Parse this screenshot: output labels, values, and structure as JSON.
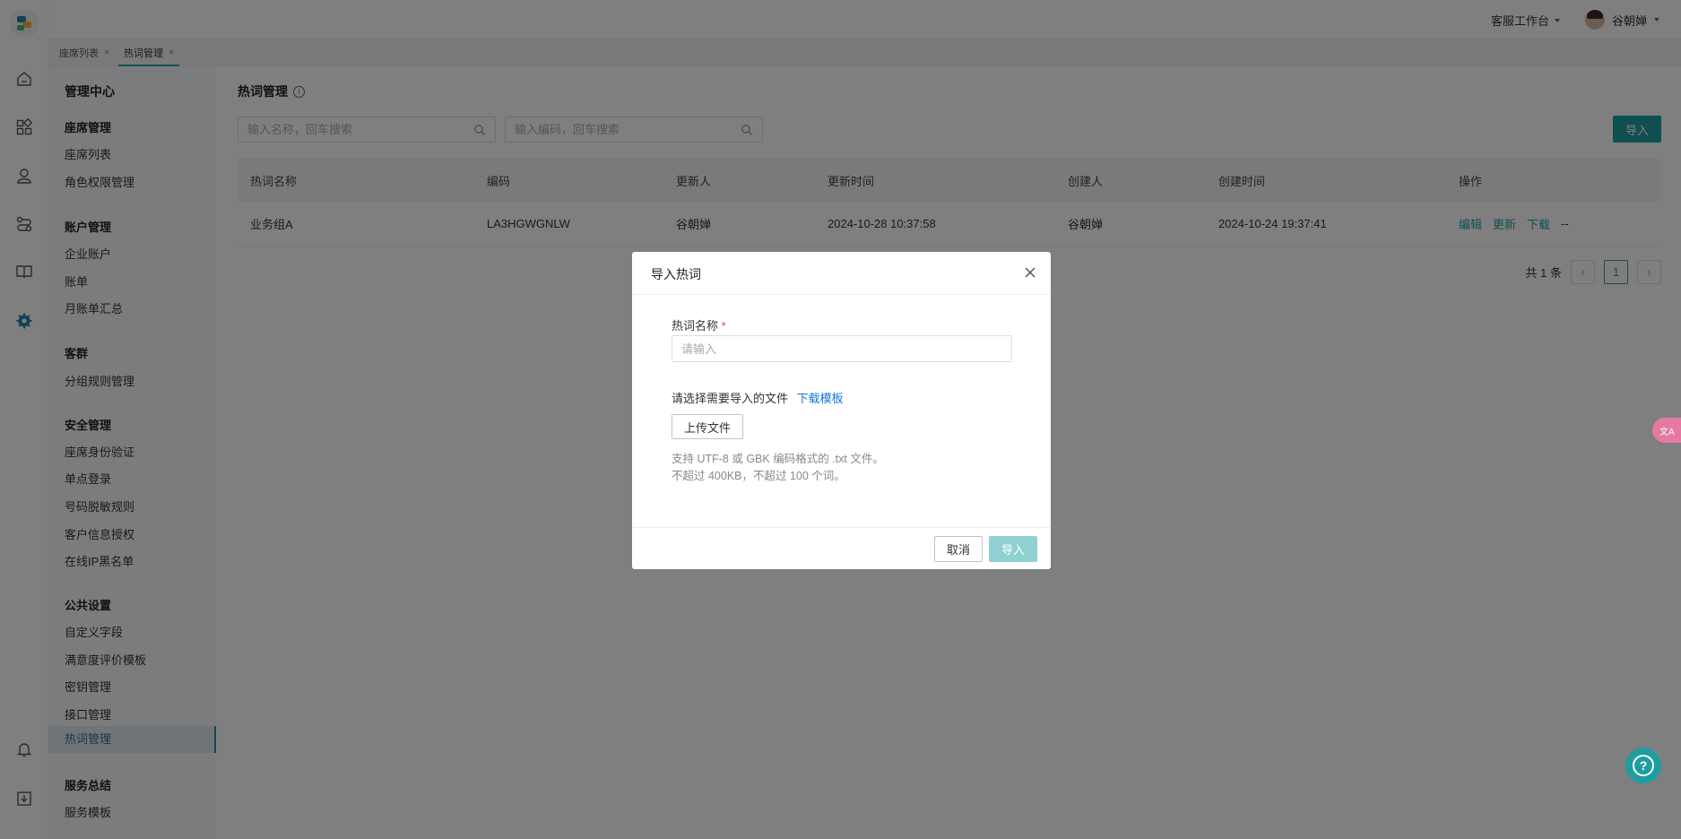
{
  "topbar": {
    "workbench_label": "客服工作台",
    "user_name": "谷朝婵"
  },
  "tabs": [
    {
      "label": "座席列表",
      "close": "×"
    },
    {
      "label": "热词管理",
      "close": "×"
    }
  ],
  "sidebar": {
    "title": "管理中心",
    "groups": [
      {
        "title": "座席管理",
        "items": [
          "座席列表",
          "角色权限管理"
        ]
      },
      {
        "title": "账户管理",
        "items": [
          "企业账户",
          "账单",
          "月账单汇总"
        ]
      },
      {
        "title": "客群",
        "items": [
          "分组规则管理"
        ]
      },
      {
        "title": "安全管理",
        "items": [
          "座席身份验证",
          "单点登录",
          "号码脱敏规则",
          "客户信息授权",
          "在线IP黑名单"
        ]
      },
      {
        "title": "公共设置",
        "items": [
          "自定义字段",
          "满意度评价模板",
          "密钥管理",
          "接口管理",
          "热词管理"
        ]
      },
      {
        "title": "服务总结",
        "items": [
          "服务模板"
        ]
      }
    ]
  },
  "main": {
    "title": "热词管理",
    "info_glyph": "i",
    "search_name_placeholder": "输入名称，回车搜索",
    "search_code_placeholder": "输入编码，回车搜索",
    "import_label": "导入",
    "table": {
      "headers": [
        "热词名称",
        "编码",
        "更新人",
        "更新时间",
        "创建人",
        "创建时间",
        "操作"
      ],
      "rows": [
        {
          "name": "业务组A",
          "code": "LA3HGWGNLW",
          "updater": "谷朝婵",
          "updated_at": "2024-10-28 10:37:58",
          "creator": "谷朝婵",
          "created_at": "2024-10-24 19:37:41",
          "actions": [
            "编辑",
            "更新",
            "下载",
            "--"
          ]
        }
      ]
    },
    "pagination": {
      "total_label": "共 1 条",
      "current_page": "1",
      "prev": "‹",
      "next": "›"
    }
  },
  "dialog": {
    "title": "导入热词",
    "name_label": "热词名称",
    "required_mark": "*",
    "name_placeholder": "请输入",
    "file_label": "请选择需要导入的文件",
    "download_template": "下载模板",
    "upload_label": "上传文件",
    "hint_line1": "支持 UTF-8 或 GBK 编码格式的 .txt 文件。",
    "hint_line2": "不超过 400KB，不超过 100 个词。",
    "cancel_label": "取消",
    "ok_label": "导入"
  },
  "floating": {
    "help_glyph": "?",
    "translate_glyph": "文A"
  },
  "colors": {
    "accent": "#1e9ea0",
    "link": "#1677d6",
    "required": "#e64545"
  }
}
